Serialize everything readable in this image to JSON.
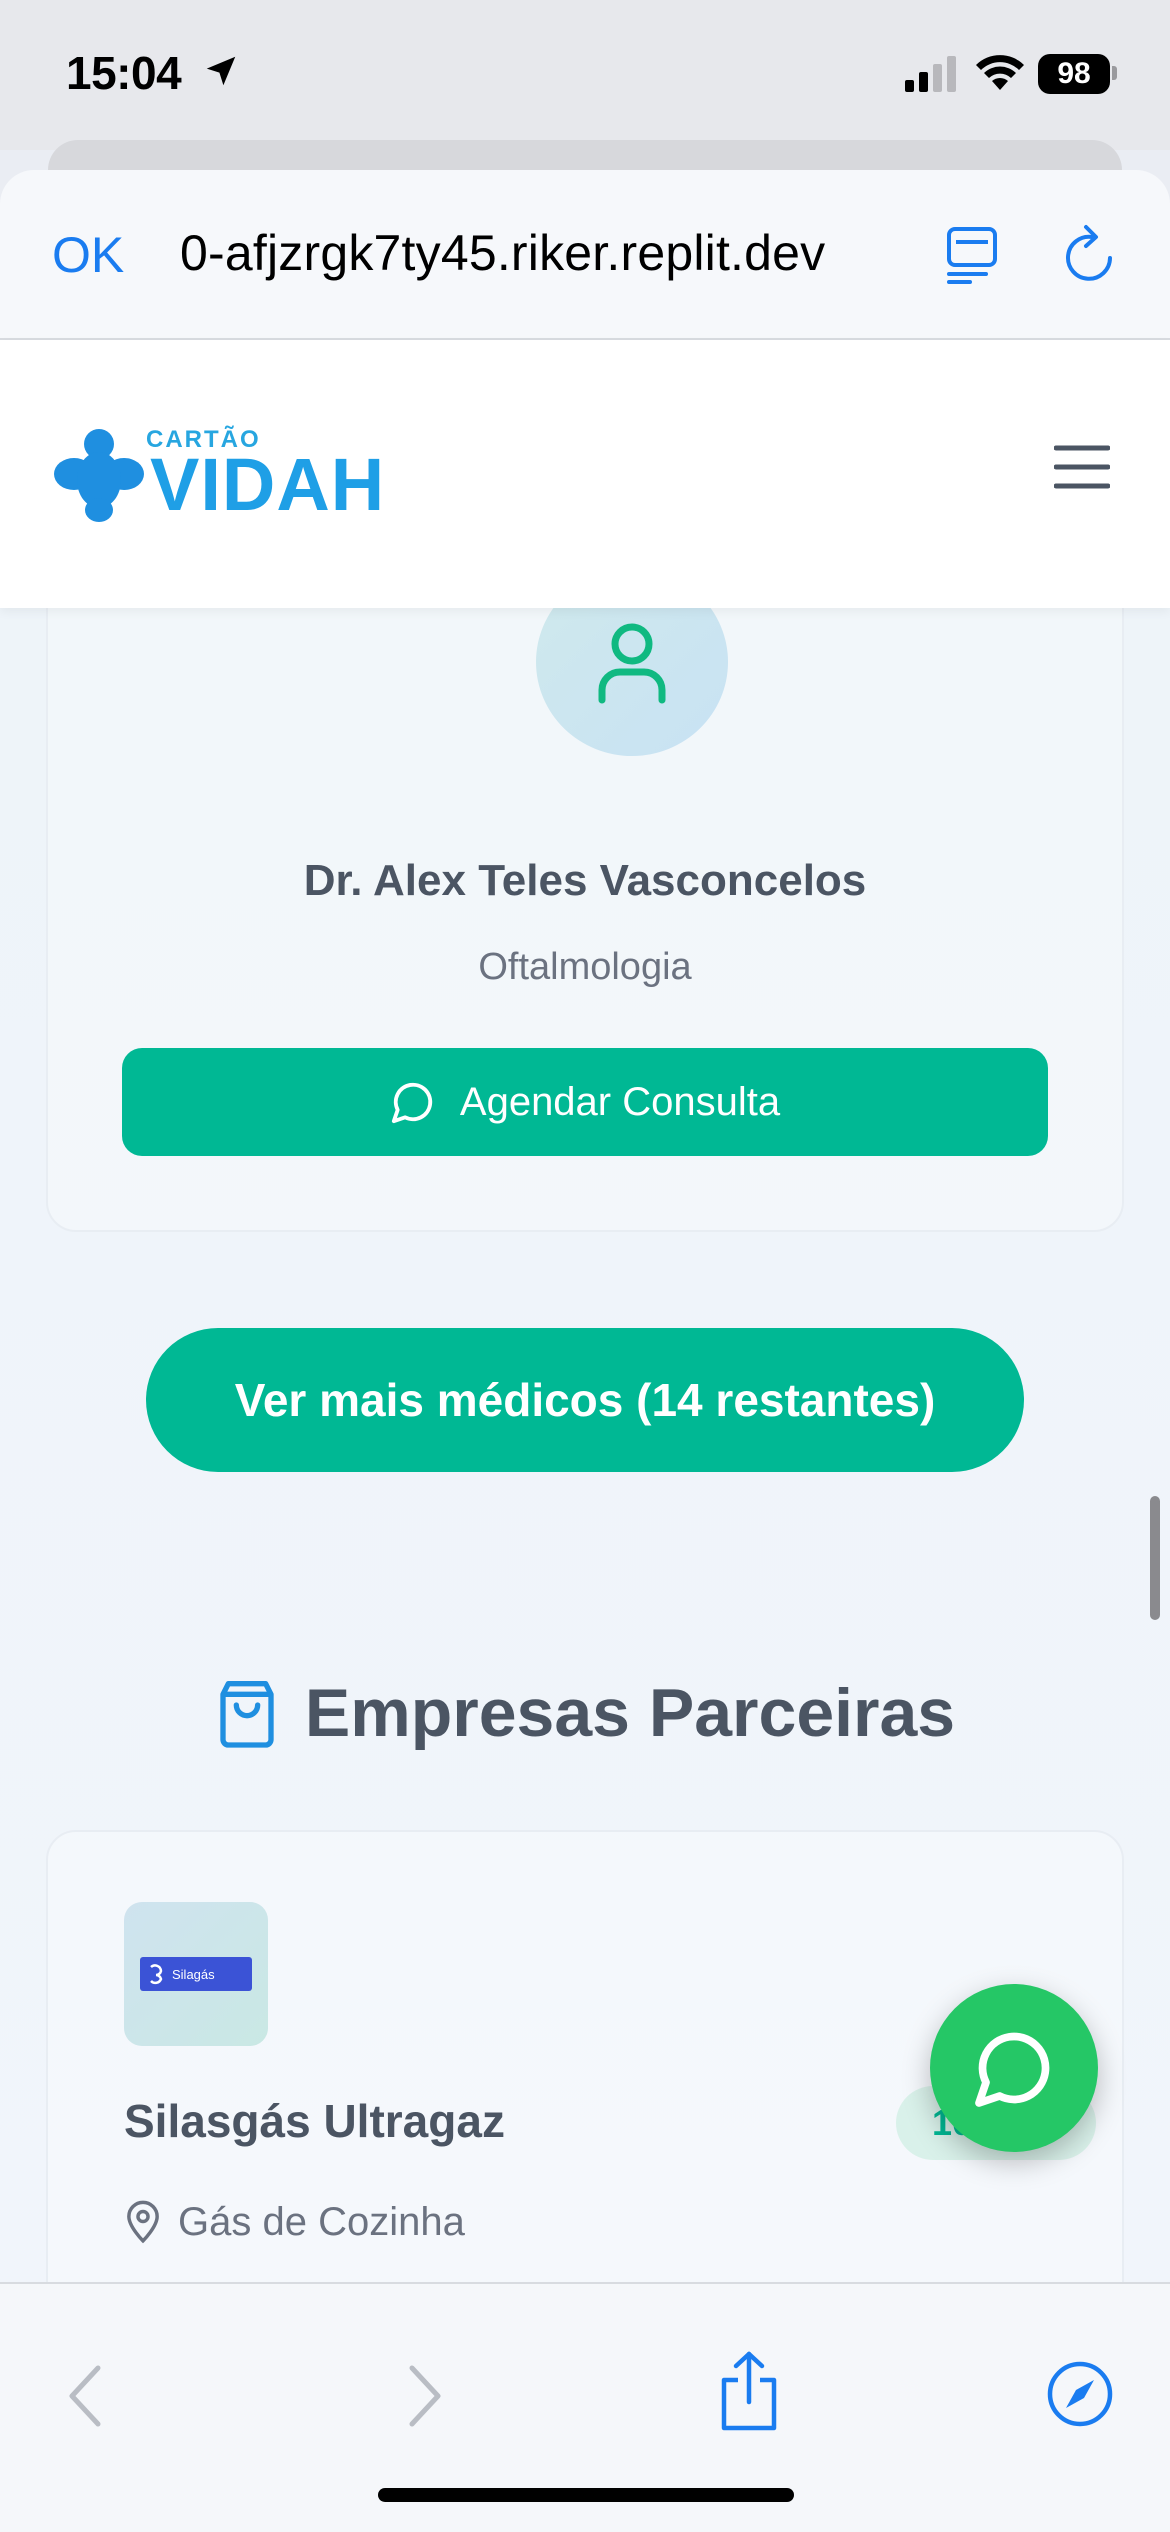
{
  "status_bar": {
    "time": "15:04",
    "battery": "98",
    "icons": [
      "location-arrow-icon",
      "cellular-signal-icon",
      "wifi-icon",
      "battery-icon"
    ]
  },
  "browser": {
    "done_label": "OK",
    "url": "0-afjzrgk7ty45.riker.replit.dev",
    "toolbar_icons": [
      "reader-icon",
      "reload-icon",
      "back-icon",
      "forward-icon",
      "share-icon",
      "compass-icon"
    ]
  },
  "site": {
    "logo_small": "CARTÃO",
    "logo_main": "VIDAH",
    "brand_color": "#1f9fe6",
    "accent_color": "#00b894"
  },
  "doctor": {
    "name": "Dr. Alex Teles Vasconcelos",
    "specialty": "Oftalmologia",
    "schedule_label": "Agendar Consulta"
  },
  "more_doctors_label": "Ver mais médicos (14 restantes)",
  "partners_section": {
    "title": "Empresas Parceiras"
  },
  "partner": {
    "logo_text": "Silagás",
    "name": "Silasgás Ultragaz",
    "discount": "10",
    "category": "Gás de Cozinha"
  }
}
